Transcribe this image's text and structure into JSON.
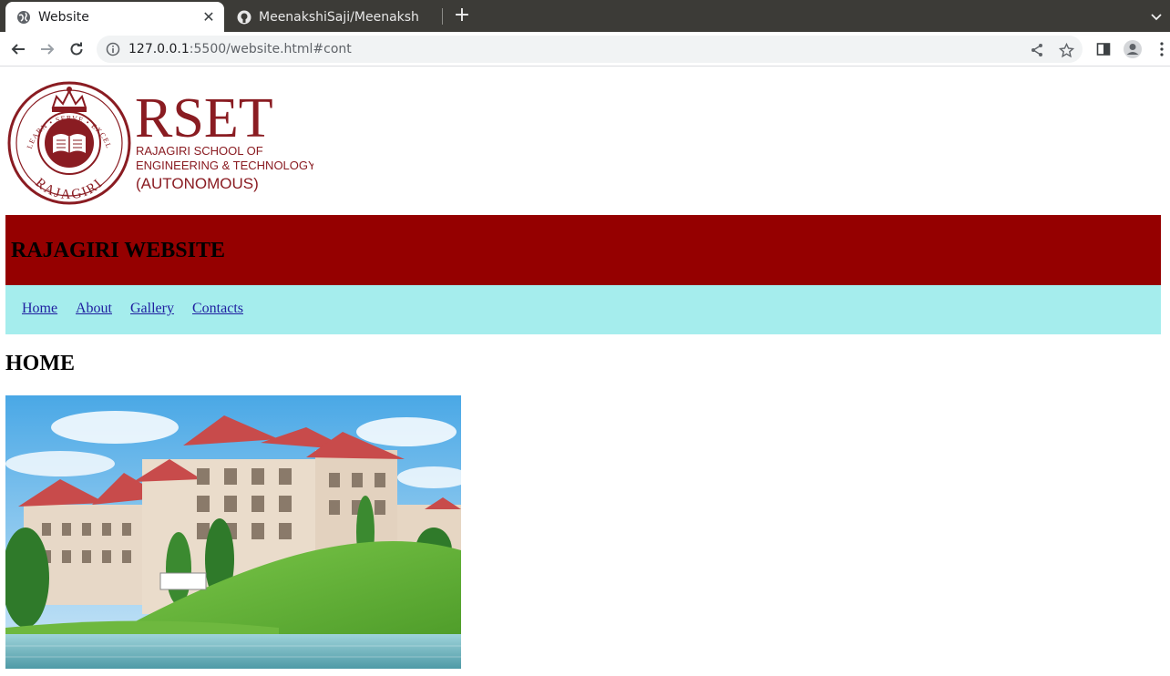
{
  "browser": {
    "tabs": [
      {
        "title": "Website",
        "active": true,
        "favicon": "globe-icon"
      },
      {
        "title": "MeenakshiSaji/Meenaksh",
        "active": false,
        "favicon": "github-icon"
      }
    ],
    "url_host": "127.0.0.1",
    "url_rest": ":5500/website.html#cont"
  },
  "site": {
    "logo": {
      "wordmark": "RSET",
      "line1": "RAJAGIRI SCHOOL OF",
      "line2": "ENGINEERING & TECHNOLOGY",
      "line3": "(AUTONOMOUS)",
      "seal_top": "LEARN • SERVE • EXCEL",
      "seal_bottom": "RAJAGIRI"
    },
    "banner_title": "RAJAGIRI WEBSITE",
    "nav": [
      "Home",
      "About",
      "Gallery",
      "Contacts"
    ],
    "section_title": "HOME"
  },
  "colors": {
    "banner": "#950000",
    "nav_bar": "#a5eded",
    "link": "#2020a0",
    "brand": "#8a1c22"
  }
}
